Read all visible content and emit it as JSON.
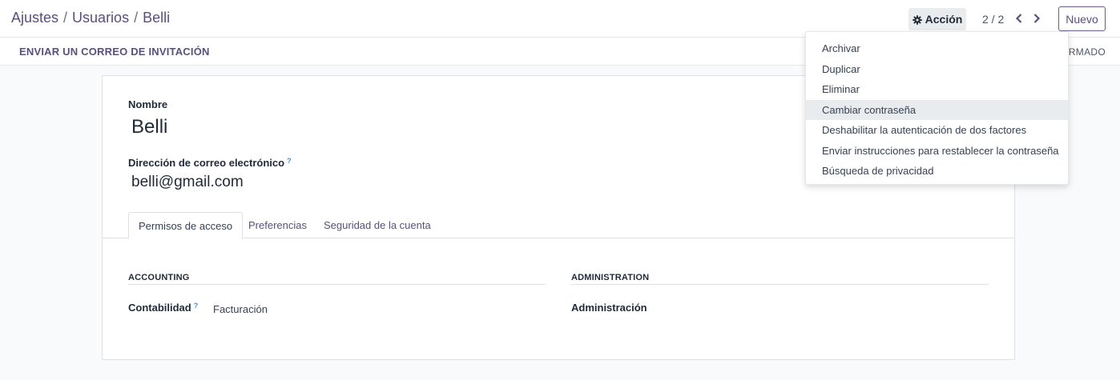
{
  "breadcrumb": {
    "items": [
      "Ajustes",
      "Usuarios"
    ],
    "separator": "/",
    "current": "Belli"
  },
  "toolbar": {
    "action_label": "Acción",
    "pager": "2 / 2",
    "new_label": "Nuevo"
  },
  "statusbar": {
    "invite_label": "ENVIAR UN CORREO DE INVITACIÓN",
    "stage_label": "IRMADO"
  },
  "form": {
    "name_label": "Nombre",
    "name_value": "Belli",
    "email_label": "Dirección de correo electrónico",
    "email_value": "belli@gmail.com",
    "help_mark": "?"
  },
  "tabs": [
    {
      "label": "Permisos de acceso",
      "active": true
    },
    {
      "label": "Preferencias",
      "active": false
    },
    {
      "label": "Seguridad de la cuenta",
      "active": false
    }
  ],
  "groups": {
    "accounting": {
      "title": "ACCOUNTING",
      "field_label": "Contabilidad",
      "field_value": "Facturación"
    },
    "administration": {
      "title": "ADMINISTRATION",
      "field_label": "Administración"
    }
  },
  "action_menu": {
    "items": [
      "Archivar",
      "Duplicar",
      "Eliminar",
      "Cambiar contraseña",
      "Deshabilitar la autenticación de dos factores",
      "Enviar instrucciones para restablecer la contraseña",
      "Búsqueda de privacidad"
    ],
    "hovered_index": 3
  },
  "colors": {
    "accent": "#5a4f7c",
    "help": "#4f8ac9",
    "hover": "#e9ecef"
  },
  "icons": {
    "action": "gear-icon",
    "prev": "chevron-left-icon",
    "next": "chevron-right-icon"
  }
}
